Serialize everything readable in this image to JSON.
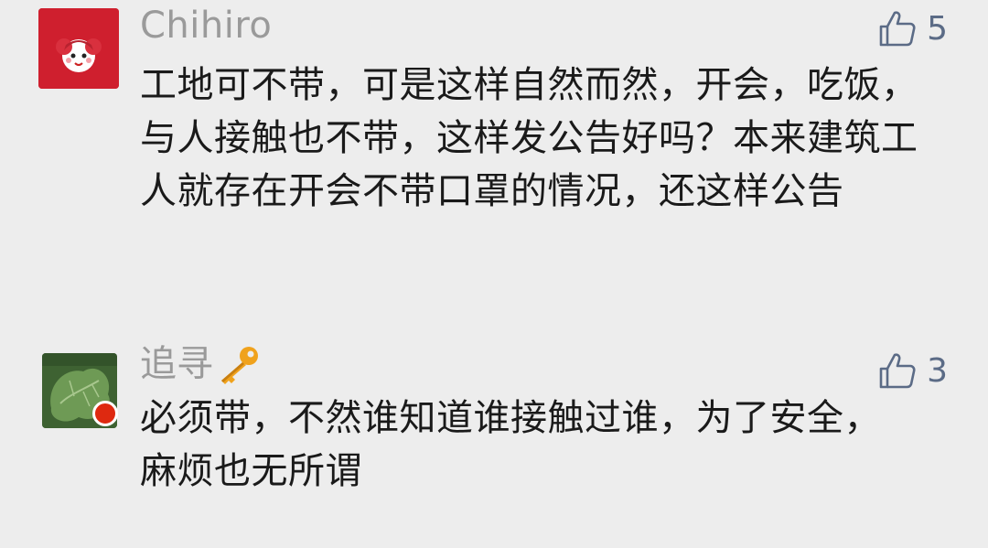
{
  "comments": [
    {
      "username": "Chihiro",
      "text": "工地可不带，可是这样自然而然，开会，吃饭，与人接触也不带，这样发公告好吗？本来建筑工人就存在开会不带口罩的情况，还这样公告",
      "likes": "5",
      "avatar_icon": "cartoon-girl-red-avatar"
    },
    {
      "username": "追寻",
      "text": "必须带，不然谁知道谁接触过谁，为了安全，麻烦也无所谓",
      "likes": "3",
      "avatar_icon": "green-leaf-avatar",
      "badge_icon": "key-icon"
    }
  ],
  "colors": {
    "background": "#ededed",
    "username": "#9a9a9a",
    "text": "#1a1a1a",
    "like": "#5b6b86"
  }
}
